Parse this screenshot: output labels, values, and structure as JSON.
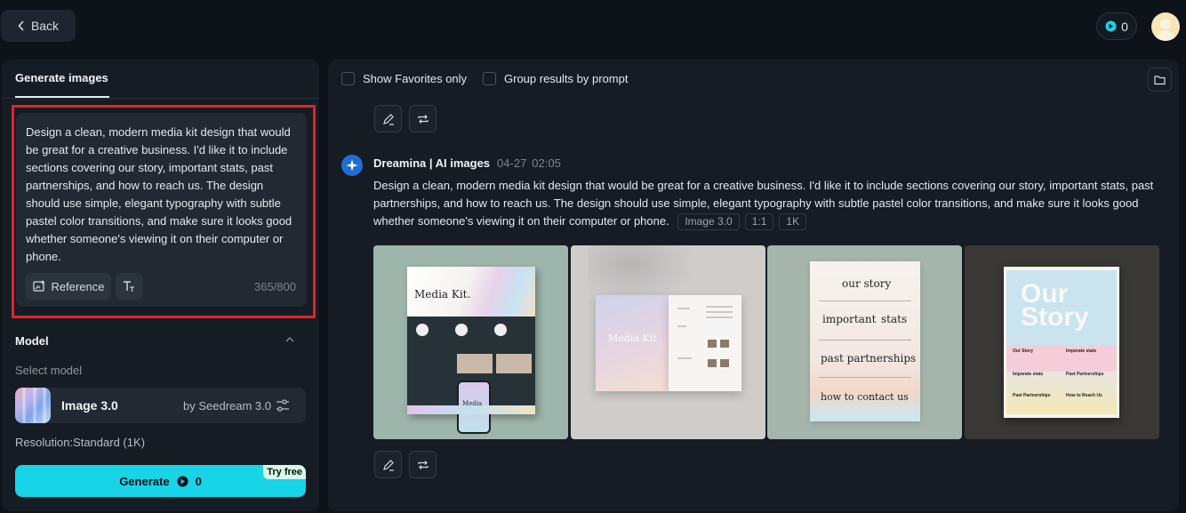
{
  "header": {
    "back_label": "Back",
    "credits": "0"
  },
  "left": {
    "tab_label": "Generate images",
    "prompt_text": "Design a clean, modern media kit design that would be great for a creative business. I'd like it to include sections covering our story, important stats, past partnerships, and how to reach us. The design should use simple, elegant typography with subtle pastel color transitions, and make sure it looks good whether someone's viewing it on their computer or phone.",
    "reference_label": "Reference",
    "char_count": "365/800",
    "model_title": "Model",
    "select_model_label": "Select model",
    "model_name": "Image 3.0",
    "model_by": "by Seedream 3.0",
    "resolution_label": "Resolution:Standard (1K)",
    "generate_label": "Generate",
    "generate_cost": "0",
    "try_free_label": "Try free"
  },
  "main": {
    "show_favorites_label": "Show Favorites only",
    "group_results_label": "Group results by prompt",
    "result": {
      "brand": "Dreamina | AI images",
      "date": "04-27",
      "time": "02:05",
      "prompt": "Design a clean, modern media kit design that would be great for a creative business. I'd like it to include sections covering our story, important stats, past partnerships, and how to reach us. The design should use simple, elegant typography with subtle pastel color transitions, and make sure it looks good whether someone's viewing it on their computer or phone.",
      "tags": [
        "Image 3.0",
        "1:1",
        "1K"
      ]
    },
    "images": {
      "tile1_title": "Media Kit.",
      "tile1_phone": "Media Kit",
      "tile2_title": "Media Kit",
      "tile3_lines": [
        "our story",
        "important",
        "stats",
        "past partnerships",
        "how to contact us"
      ],
      "tile4_title_1": "Our",
      "tile4_title_2": "Story",
      "tile4_labels": [
        "Our Story",
        "Imporate stats",
        "Imporate stats",
        "Past Partnerships",
        "Past Partnerships",
        "How to Reach Us"
      ]
    }
  },
  "colors": {
    "accent": "#19d3e6",
    "highlight": "#e0242c",
    "panel": "#161c24",
    "background": "#0e131a"
  }
}
